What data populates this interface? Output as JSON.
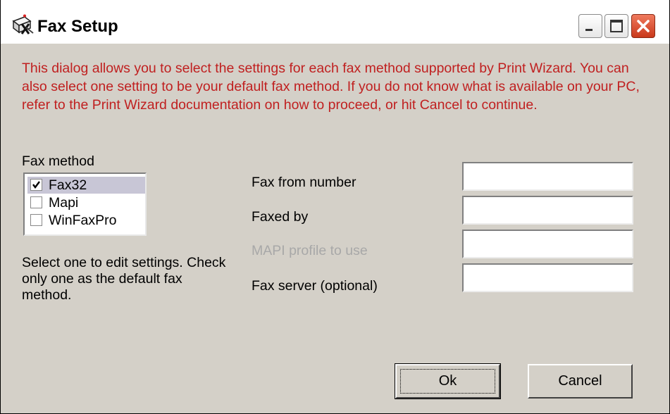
{
  "window": {
    "title": "Fax Setup",
    "icon": "fax-machine-icon",
    "controls": [
      "minimize-icon",
      "maximize-icon",
      "close-icon"
    ],
    "close_color": "#c9391b"
  },
  "info_text": "This dialog allows you to select the settings for each fax method supported by Print Wizard. You can also select one setting to be your default fax method. If you do not know what is available on your PC, refer to the Print Wizard documentation on how to proceed, or hit Cancel to continue.",
  "info_color": "#c02020",
  "fax_method": {
    "label": "Fax method",
    "items": [
      {
        "label": "Fax32",
        "checked": true,
        "selected": true
      },
      {
        "label": "Mapi",
        "checked": false,
        "selected": false
      },
      {
        "label": "WinFaxPro",
        "checked": false,
        "selected": false
      }
    ],
    "hint": "Select one to edit settings. Check only one as the default fax method."
  },
  "fields": [
    {
      "label": "Fax from number",
      "value": "",
      "disabled": false
    },
    {
      "label": "Faxed by",
      "value": "",
      "disabled": false
    },
    {
      "label": "MAPI profile to use",
      "value": "",
      "disabled": true
    },
    {
      "label": "Fax server (optional)",
      "value": "",
      "disabled": false
    }
  ],
  "buttons": {
    "ok": "Ok",
    "cancel": "Cancel"
  }
}
